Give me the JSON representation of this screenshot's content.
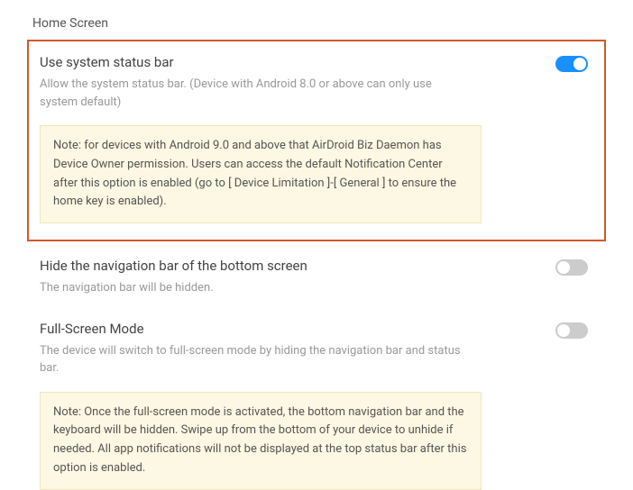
{
  "header": {
    "title": "Home Screen"
  },
  "settings": [
    {
      "title": "Use system status bar",
      "description": "Allow the system status bar. (Device with Android 8.0 or above can only use system default)",
      "note": "Note: for devices with Android 9.0 and above that AirDroid Biz Daemon has Device Owner permission. Users can access the default Notification Center after this option is enabled (go to [ Device Limitation ]-[ General ] to ensure the home key is enabled).",
      "enabled": true
    },
    {
      "title": "Hide the navigation bar of the bottom screen",
      "description": "The navigation bar will be hidden.",
      "enabled": false
    },
    {
      "title": "Full-Screen Mode",
      "description": "The device will switch to full-screen mode by hiding the navigation bar and status bar.",
      "note": "Note: Once the full-screen mode is activated, the bottom navigation bar and the keyboard will be hidden. Swipe up from the bottom of your device to unhide if needed. All app notifications will not be displayed at the top status bar after this option is enabled.",
      "enabled": false
    }
  ]
}
